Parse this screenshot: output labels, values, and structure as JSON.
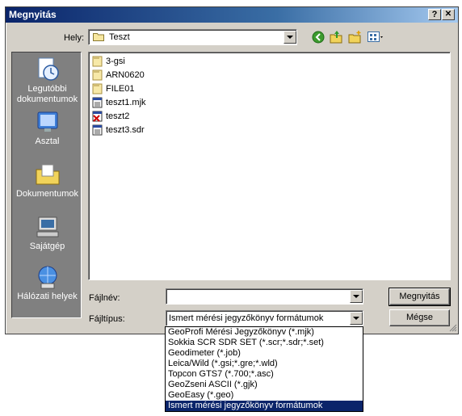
{
  "window": {
    "title": "Megnyitás",
    "help_btn": "?",
    "close_btn": "✕"
  },
  "location": {
    "label": "Hely:",
    "value": "Teszt"
  },
  "places": [
    {
      "label": "Legutóbbi dokumentumok",
      "icon": "recent-documents-icon"
    },
    {
      "label": "Asztal",
      "icon": "desktop-icon"
    },
    {
      "label": "Dokumentumok",
      "icon": "documents-folder-icon"
    },
    {
      "label": "Sajátgép",
      "icon": "my-computer-icon"
    },
    {
      "label": "Hálózati helyek",
      "icon": "network-places-icon"
    }
  ],
  "files": [
    {
      "name": "3-gsi",
      "type": "folder"
    },
    {
      "name": "ARN0620",
      "type": "folder"
    },
    {
      "name": "FILE01",
      "type": "folder"
    },
    {
      "name": "teszt1.mjk",
      "type": "file"
    },
    {
      "name": "teszt2",
      "type": "file-error"
    },
    {
      "name": "teszt3.sdr",
      "type": "file"
    }
  ],
  "filename": {
    "label": "Fájlnév:",
    "value": ""
  },
  "filetype": {
    "label": "Fájltípus:",
    "value": "Ismert mérési jegyzőkönyv formátumok",
    "options": [
      "GeoProfi Mérési Jegyzőkönyv (*.mjk)",
      "Sokkia SCR SDR SET (*.scr;*.sdr;*.set)",
      "Geodimeter (*.job)",
      "Leica/Wild (*.gsi;*.gre;*.wld)",
      "Topcon GTS7 (*.700;*.asc)",
      "GeoZseni ASCII (*.gjk)",
      "GeoEasy (*.geo)",
      "Ismert mérési jegyzőkönyv formátumok"
    ],
    "selected_index": 7
  },
  "buttons": {
    "open": "Megnyitás",
    "cancel": "Mégse"
  },
  "toolbar": [
    "back-icon",
    "up-folder-icon",
    "new-folder-icon",
    "views-menu-icon"
  ]
}
